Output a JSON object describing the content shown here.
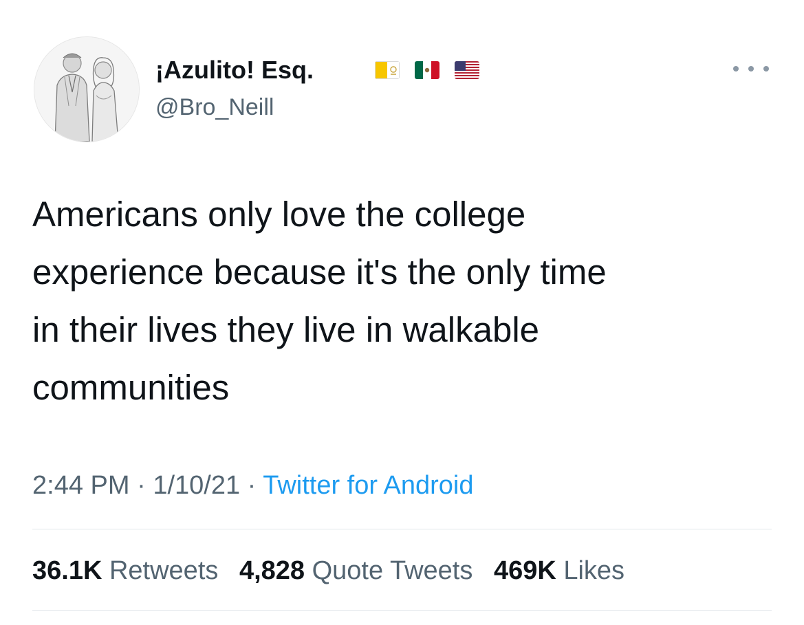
{
  "tweet": {
    "author": {
      "display_name": "¡Azulito! Esq.",
      "handle": "@Bro_Neill",
      "flags": [
        "vatican-flag-icon",
        "mexico-flag-icon",
        "usa-flag-icon"
      ]
    },
    "text": "Americans only love the college\nexperience because it's the only time\nin their lives they live in walkable\ncommunities",
    "time": "2:44 PM",
    "separator": "·",
    "date": "1/10/21",
    "source": "Twitter for Android",
    "stats": {
      "retweets_count": "36.1K",
      "retweets_label": "Retweets",
      "quotes_count": "4,828",
      "quotes_label": "Quote Tweets",
      "likes_count": "469K",
      "likes_label": "Likes"
    }
  },
  "colors": {
    "text_primary": "#0f1419",
    "text_secondary": "#536471",
    "link": "#1d9bf0",
    "divider": "#e1e6ea"
  }
}
